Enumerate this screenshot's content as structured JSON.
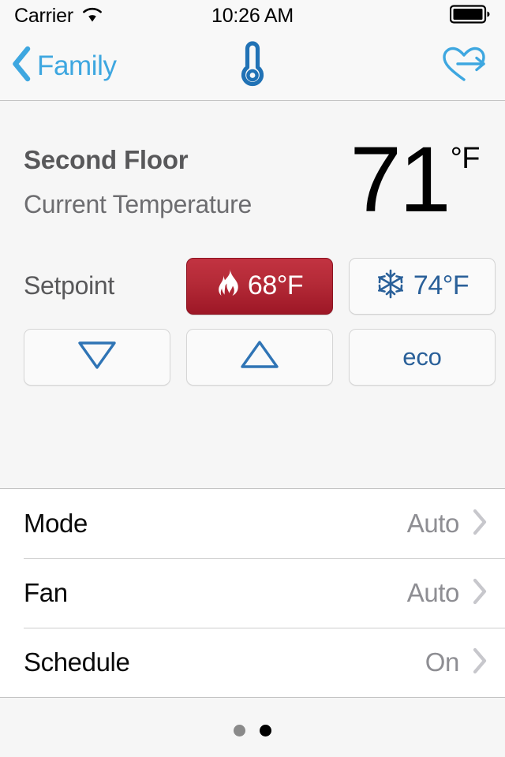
{
  "status_bar": {
    "carrier": "Carrier",
    "wifi_icon": "wifi-icon",
    "time": "10:26 AM",
    "battery_icon": "battery-full-icon"
  },
  "nav_bar": {
    "back_icon": "chevron-left-icon",
    "back_label": "Family",
    "title_icon": "thermometer-icon",
    "action_icon": "heart-share-icon"
  },
  "overview": {
    "zone_name": "Second Floor",
    "zone_subtitle": "Current Temperature",
    "current_temp": "71",
    "current_unit": "°F"
  },
  "setpoint": {
    "label": "Setpoint",
    "heat": {
      "icon": "flame-icon",
      "value": "68°F",
      "active": true,
      "color": "#b42a37"
    },
    "cool": {
      "icon": "snowflake-icon",
      "value": "74°F",
      "active": false,
      "color": "#2a6099"
    }
  },
  "controls": [
    {
      "name": "decrease",
      "icon": "triangle-down-icon",
      "label": ""
    },
    {
      "name": "increase",
      "icon": "triangle-up-icon",
      "label": ""
    },
    {
      "name": "eco",
      "icon": "",
      "label": "eco"
    }
  ],
  "settings_list": [
    {
      "label": "Mode",
      "value": "Auto",
      "chevron": "chevron-right-icon"
    },
    {
      "label": "Fan",
      "value": "Auto",
      "chevron": "chevron-right-icon"
    },
    {
      "label": "Schedule",
      "value": "On",
      "chevron": "chevron-right-icon"
    }
  ],
  "pagination": {
    "total": 2,
    "active_index": 1
  },
  "theme": {
    "tint_blue": "#3ea7e0",
    "deep_blue": "#2a6099",
    "heat_red": "#b42a37",
    "gray_text": "#8e8e93",
    "panel_bg": "#f6f6f6"
  }
}
